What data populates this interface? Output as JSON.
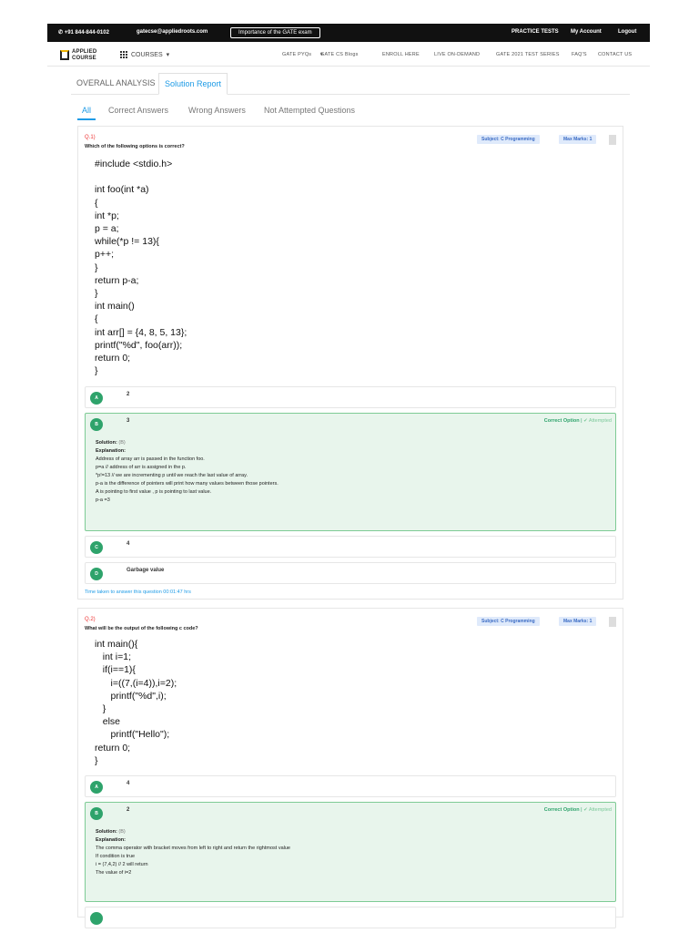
{
  "topbar": {
    "phone": "+91 844-844-0102",
    "email": "gatecse@appliedroots.com",
    "gate_button": "Importance of the GATE exam",
    "practice_tests": "PRACTICE TESTS",
    "my_account": "My Account",
    "logout": "Logout"
  },
  "navbar": {
    "logo_line1": "APPLIED",
    "logo_line2": "COURSE",
    "courses": "COURSES",
    "links": [
      "GATE PYQs",
      "GATE CS Blogs",
      "ENROLL HERE",
      "LIVE ON-DEMAND",
      "GATE 2021 TEST SERIES",
      "FAQ'S",
      "CONTACT US"
    ]
  },
  "main_tabs": [
    "OVERALL ANALYSIS",
    "Solution Report"
  ],
  "filter_tabs": [
    "All",
    "Correct Answers",
    "Wrong Answers",
    "Not Attempted Questions"
  ],
  "questions": [
    {
      "number": "Q.1)",
      "text": "Which of the following options is correct?",
      "subject": "Subject: C Programming",
      "marks": "Max Marks: 1",
      "code": "#include <stdio.h>\n\nint foo(int *a)\n{\nint *p;\np = a;\nwhile(*p != 13){\np++;\n}\nreturn p-a;\n}\nint main()\n{\nint arr[] = {4, 8, 5, 13};\nprintf(\"%d\", foo(arr));\nreturn 0;\n}",
      "options": [
        {
          "letter": "A",
          "text": "2"
        },
        {
          "letter": "B",
          "text": "3"
        },
        {
          "letter": "C",
          "text": "4"
        },
        {
          "letter": "D",
          "text": "Garbage value"
        }
      ],
      "correct_label": "Correct Option",
      "attempted_label": "Attempted",
      "solution_label": "Solution:",
      "solution_answer": "(B)",
      "explanation_label": "Explanation:",
      "explanation": [
        "Address of array arr is passed in the function foo.",
        "p=a // address of arr is assigned in the p.",
        "*p!=13 // we are incrementing p until we reach the last value of array.",
        "p-a is the difference of pointers will print how many values between those pointers.",
        "A is pointing to first value , p is pointing to last value.",
        "p-a =3"
      ],
      "time_taken": "Time taken to answer this question 00:01:47 hrs"
    },
    {
      "number": "Q.2)",
      "text": "What will be the output of the following c code?",
      "subject": "Subject: C Programming",
      "marks": "Max Marks: 1",
      "code": "int main(){\n   int i=1;\n   if(i==1){\n      i=((7,(i=4)),i=2);\n      printf(\"%d\",i);\n   }\n   else\n      printf(\"Hello\");\nreturn 0;\n}",
      "options": [
        {
          "letter": "A",
          "text": "4"
        },
        {
          "letter": "B",
          "text": "2"
        }
      ],
      "correct_label": "Correct Option",
      "attempted_label": "Attempted",
      "solution_label": "Solution:",
      "solution_answer": "(B)",
      "explanation_label": "Explanation:",
      "explanation": [
        "The comma operator  with bracket moves from left to right and return the rightmost value",
        "If condition is true",
        "i = (7,4,2) // 2 will return",
        "The value of i=2"
      ]
    }
  ]
}
